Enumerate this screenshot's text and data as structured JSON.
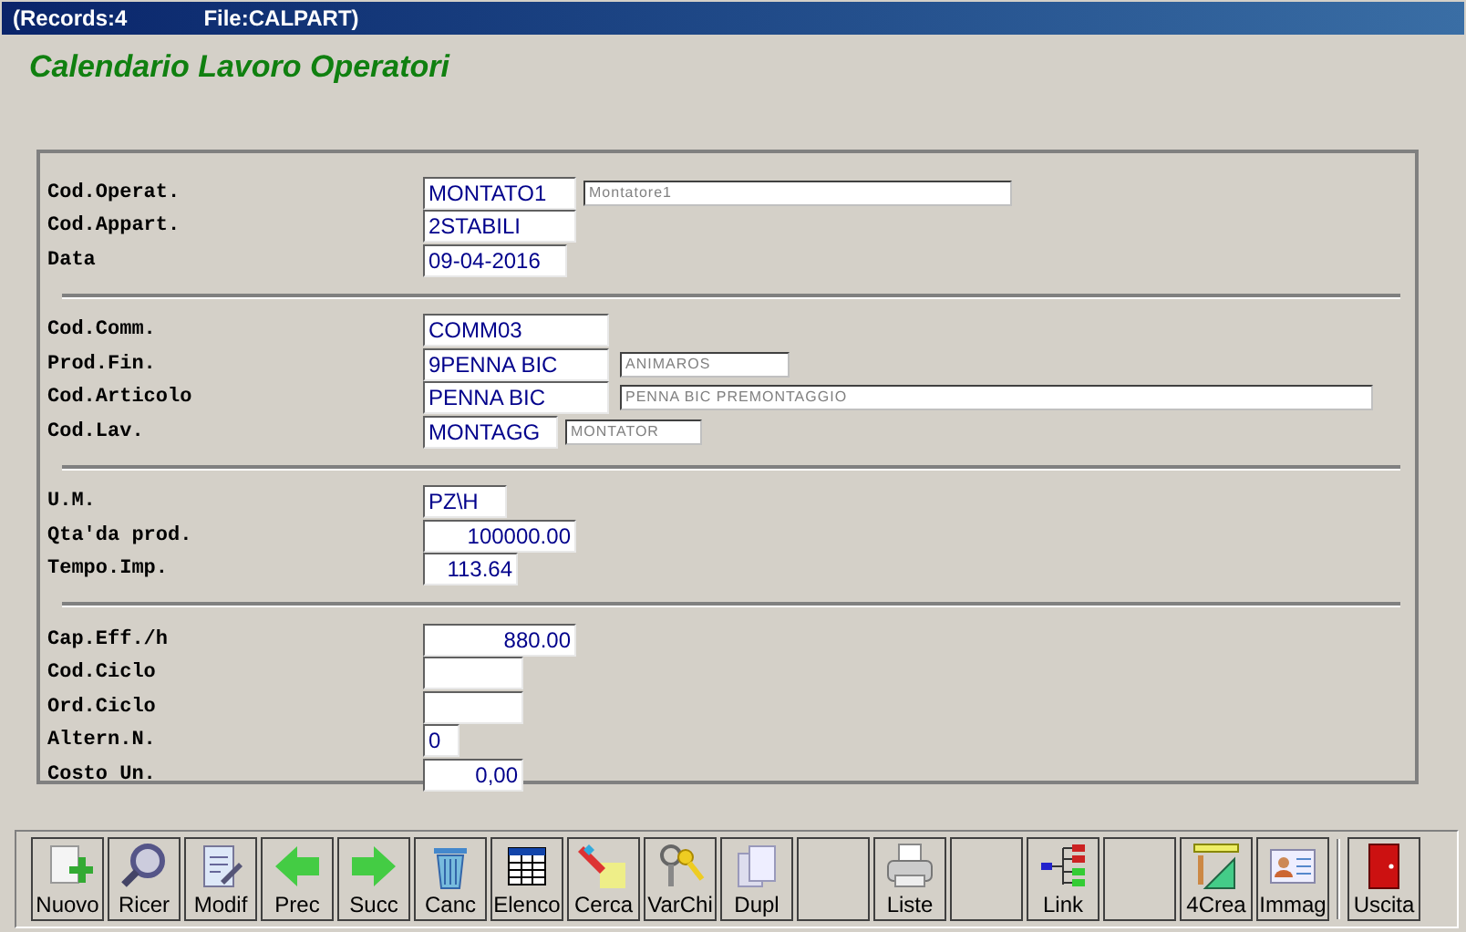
{
  "title_bar": {
    "records": "(Records:4",
    "file": "File:CALPART)"
  },
  "form_title": "Calendario Lavoro Operatori",
  "sections": [
    {
      "rows": [
        {
          "label": "Cod.Operat.",
          "value": "MONTATO1",
          "description": "Montatore1"
        },
        {
          "label": "Cod.Appart.",
          "value": "2STABILI"
        },
        {
          "label": "Data",
          "value": "09-04-2016"
        }
      ]
    },
    {
      "rows": [
        {
          "label": "Cod.Comm.",
          "value": "COMM03"
        },
        {
          "label": "Prod.Fin.",
          "value": "9PENNA BIC",
          "description": "ANIMAROS"
        },
        {
          "label": "Cod.Articolo",
          "value": "PENNA BIC",
          "description": "PENNA BIC PREMONTAGGIO"
        },
        {
          "label": "Cod.Lav.",
          "value": "MONTAGG",
          "description": "MONTATOR"
        }
      ]
    },
    {
      "rows": [
        {
          "label": "U.M.",
          "value": "PZ\\H"
        },
        {
          "label": "Qta'da prod.",
          "value": "100000.00"
        },
        {
          "label": "Tempo.Imp.",
          "value": "113.64"
        }
      ]
    },
    {
      "rows": [
        {
          "label": "Cap.Eff./h",
          "value": "880.00"
        },
        {
          "label": "Cod.Ciclo"
        },
        {
          "label": "Ord.Ciclo"
        },
        {
          "label": "Altern.N.",
          "value": "0"
        },
        {
          "label": "Costo Un.",
          "value": "0,00"
        }
      ]
    }
  ],
  "toolbar": [
    {
      "kind": "new",
      "label": "Nuovo"
    },
    {
      "kind": "search",
      "label": "Ricer"
    },
    {
      "kind": "edit",
      "label": "Modif"
    },
    {
      "kind": "prev",
      "label": "Prec"
    },
    {
      "kind": "next",
      "label": "Succ"
    },
    {
      "kind": "delete",
      "label": "Canc"
    },
    {
      "kind": "table",
      "label": "Elenco"
    },
    {
      "kind": "find",
      "label": "Cerca"
    },
    {
      "kind": "keys",
      "label": "VarChi"
    },
    {
      "kind": "copy",
      "label": "Dupl"
    },
    {
      "kind": "blank"
    },
    {
      "kind": "print",
      "label": "Liste"
    },
    {
      "kind": "blank"
    },
    {
      "kind": "link",
      "label": "Link"
    },
    {
      "kind": "blank"
    },
    {
      "kind": "create",
      "label": "4Crea"
    },
    {
      "kind": "image",
      "label": "Immag"
    },
    {
      "kind": "exit",
      "label": "Uscita"
    }
  ]
}
